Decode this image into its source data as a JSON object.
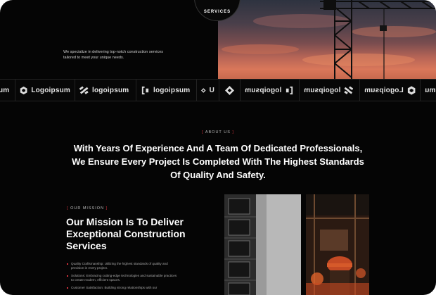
{
  "hero": {
    "badge": "SERVICES",
    "text": "We specialize in delivering top-notch construction services tailored to meet your unique needs."
  },
  "logos": {
    "items": [
      {
        "label": "um",
        "icon": "logo-mark-icon",
        "mirrored": false
      },
      {
        "label": "Logoipsum",
        "icon": "hexagon-logo-icon",
        "mirrored": false
      },
      {
        "label": "logoipsum",
        "icon": "stripes-logo-icon",
        "mirrored": false
      },
      {
        "label": "logoipsum",
        "icon": "bracket-logo-icon",
        "mirrored": false
      },
      {
        "label": "U",
        "icon": "diamond-logo-icon",
        "mirrored": false
      },
      {
        "label": "logoipsum",
        "icon": "diamond-logo-icon",
        "mirrored": true
      },
      {
        "label": "logoipsum",
        "icon": "bracket-logo-icon",
        "mirrored": true
      },
      {
        "label": "logoipsum",
        "icon": "stripes-logo-icon",
        "mirrored": true
      },
      {
        "label": "Logoipsum",
        "icon": "hexagon-logo-icon",
        "mirrored": true
      },
      {
        "label": "mu",
        "icon": "logo-mark-icon",
        "mirrored": true
      }
    ]
  },
  "about": {
    "tag": "ABOUT US",
    "heading_line1": "With Years Of Experience And A Team Of Dedicated Professionals,",
    "heading_line2": "We Ensure Every Project Is Completed With The Highest Standards",
    "heading_line3": "Of Quality And Safety."
  },
  "mission": {
    "tag": "OUR MISSION",
    "heading_line1": "Our Mission Is To Deliver",
    "heading_line2": "Exceptional Construction",
    "heading_line3": "Services",
    "points": [
      "Quality Craftsmanship: Utilizing the highest standards of quality and precision in every project.",
      "Solutions: Embracing cutting-edge technologies and sustainable practices to create modern, efficient spaces.",
      "Customer Satisfaction: Building strong relationships with our"
    ]
  },
  "colors": {
    "background": "#050505",
    "accent": "#d0323b",
    "sky_warm": "#d9775a"
  }
}
